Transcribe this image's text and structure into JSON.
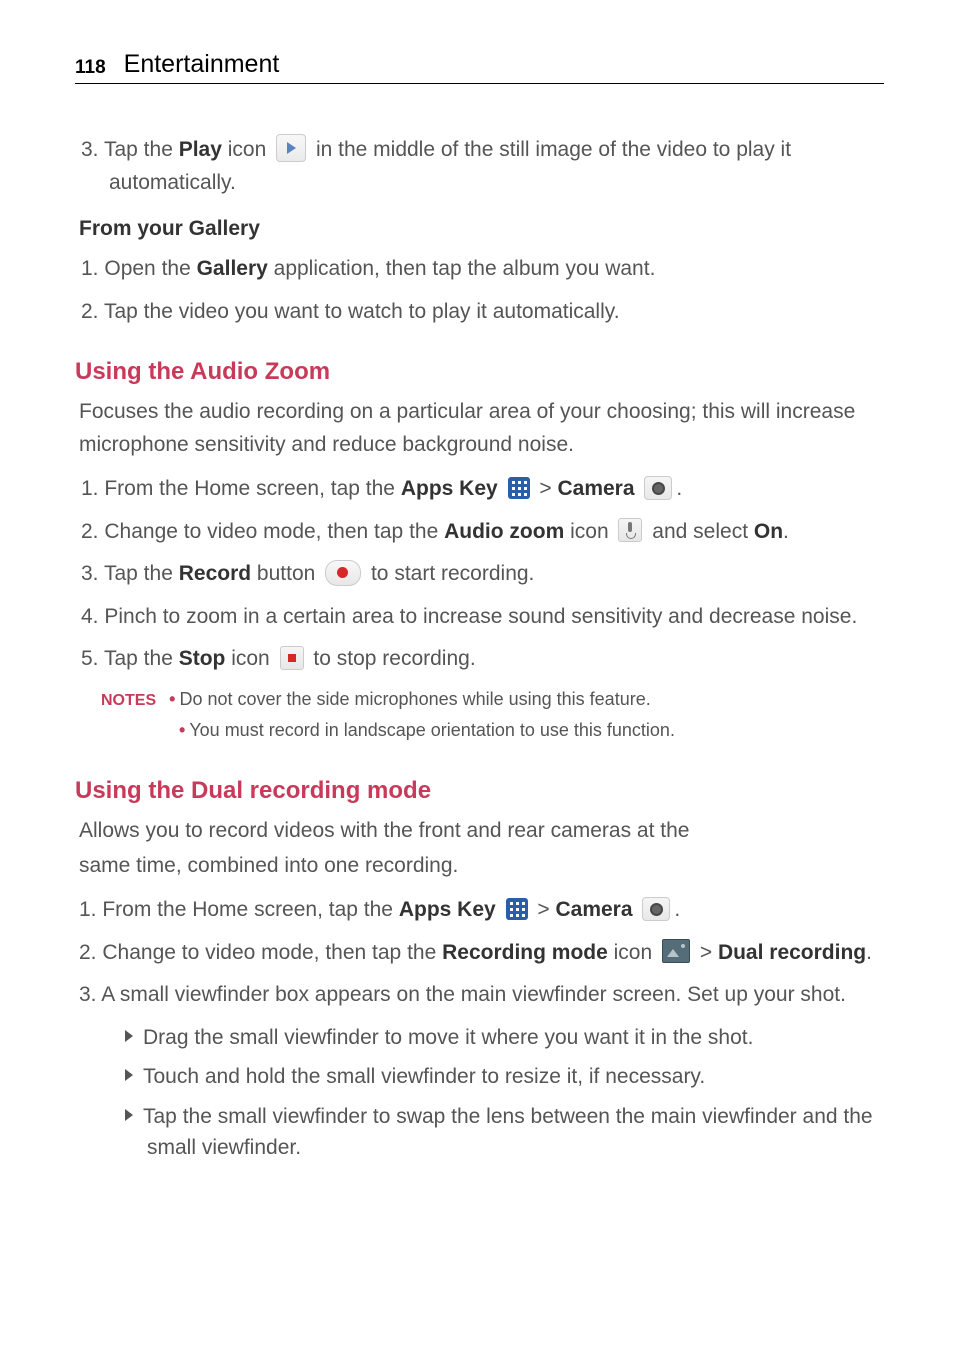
{
  "header": {
    "page_number": "118",
    "title": "Entertainment"
  },
  "top_step": {
    "num": "3.",
    "t1": "Tap the ",
    "bold1": "Play",
    "t2": " icon ",
    "t3": " in the middle of the still image of the video to play it automatically."
  },
  "gallery": {
    "heading": "From your Gallery",
    "s1": {
      "num": "1.",
      "t1": "Open the ",
      "bold1": "Gallery",
      "t2": " application, then tap the album you want."
    },
    "s2": {
      "num": "2.",
      "t1": "Tap the video you want to watch to play it automatically."
    }
  },
  "audio_zoom": {
    "heading": "Using the Audio Zoom",
    "intro": "Focuses the audio recording on a particular area of your choosing; this will increase microphone sensitivity and reduce background noise.",
    "s1": {
      "num": "1.",
      "t1": "From the Home screen, tap the ",
      "bold1": "Apps Key",
      "gt1": " > ",
      "bold2": "Camera",
      "dot": "."
    },
    "s2": {
      "num": "2.",
      "t1": "Change to video mode, then tap the ",
      "bold1": "Audio zoom",
      "t2": " icon ",
      "t3": " and select ",
      "bold2": "On",
      "dot": "."
    },
    "s3": {
      "num": "3.",
      "t1": "Tap the ",
      "bold1": "Record",
      "t2": " button ",
      "t3": " to start recording."
    },
    "s4": {
      "num": "4.",
      "t1": "Pinch to zoom in a certain area to increase sound sensitivity and decrease noise."
    },
    "s5": {
      "num": "5.",
      "t1": "Tap the ",
      "bold1": "Stop",
      "t2": " icon ",
      "t3": " to stop recording."
    },
    "notes_label": "NOTES",
    "note1": "Do not cover the side microphones while using this feature.",
    "note2": "You must record in landscape orientation to use this function."
  },
  "dual": {
    "heading": "Using the Dual recording mode",
    "intro1": "Allows you to record videos with the front and rear cameras at the",
    "intro2": "same time, combined into one recording.",
    "s1": {
      "num": "1.",
      "t1": "From the Home screen, tap the ",
      "bold1": "Apps Key",
      "gt1": " > ",
      "bold2": "Camera",
      "dot": "."
    },
    "s2": {
      "num": "2.",
      "t1": "Change to video mode, then tap the ",
      "bold1": "Recording mode",
      "t2": " icon ",
      "gt1": " > ",
      "bold2": "Dual recording",
      "dot": "."
    },
    "s3": {
      "num": "3.",
      "t1": "A small viewfinder box appears on the main viewfinder screen. Set up your shot."
    },
    "b1": "Drag the small viewfinder to move it where you want it in the shot.",
    "b2": "Touch and hold the small viewfinder to resize it, if necessary.",
    "b3": "Tap the small viewfinder to swap the lens between the main viewfinder and the small viewfinder."
  }
}
